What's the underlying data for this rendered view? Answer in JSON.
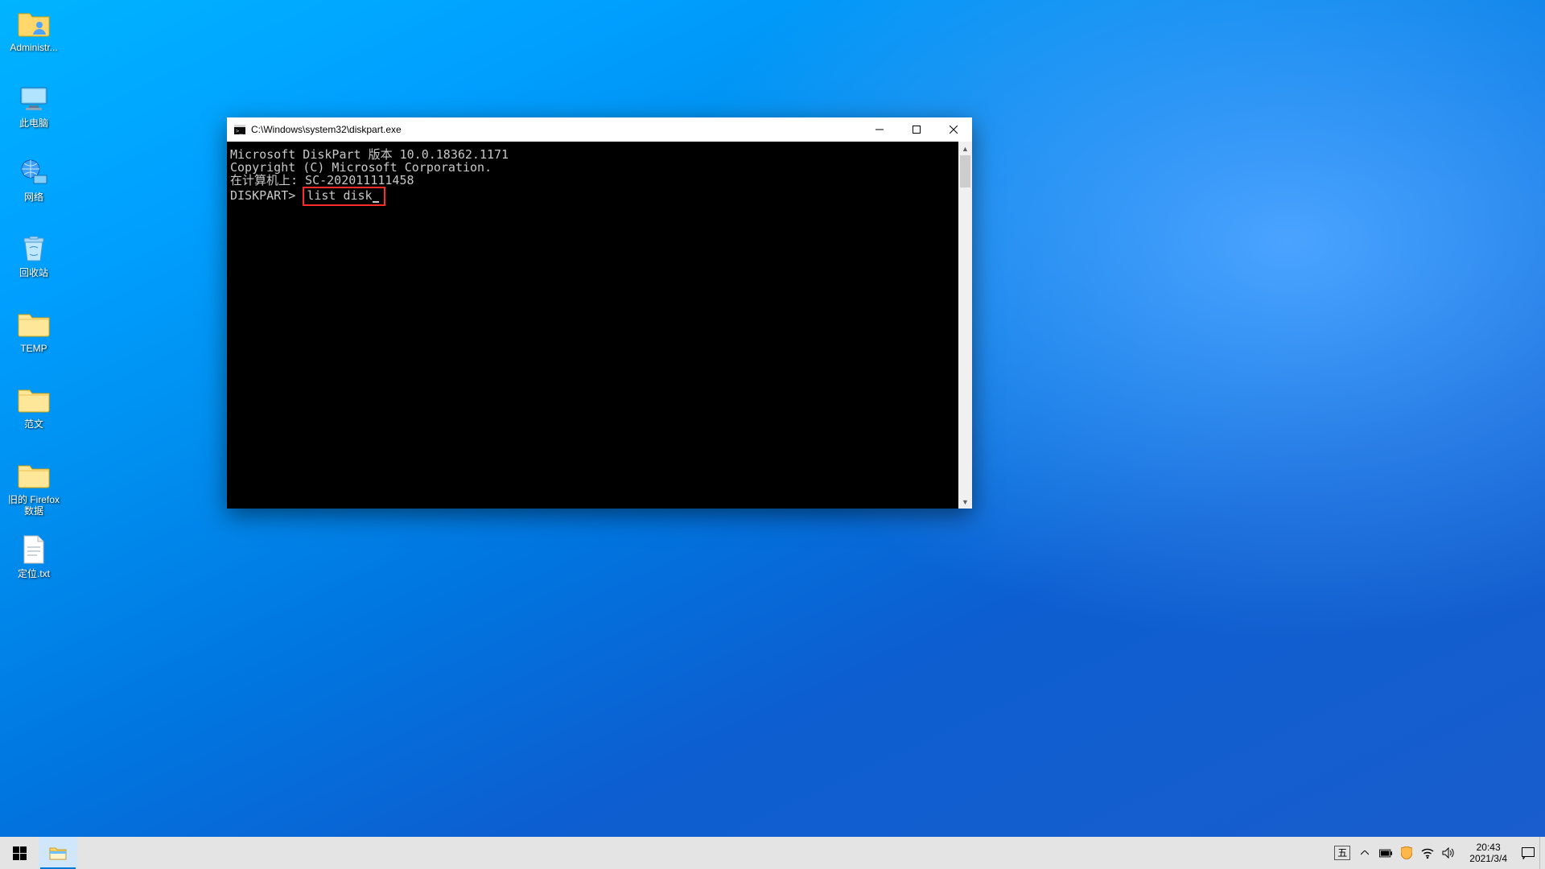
{
  "desktop_icons": {
    "admin": "Administr...",
    "pc": "此电脑",
    "net": "网络",
    "recycle": "回收站",
    "temp": "TEMP",
    "fanwen": "范文",
    "firefox": "旧的 Firefox 数据",
    "dingwei": "定位.txt"
  },
  "window": {
    "title": "C:\\Windows\\system32\\diskpart.exe",
    "lines": {
      "l1": "Microsoft DiskPart 版本 10.0.18362.1171",
      "l2": "",
      "l3": "Copyright (C) Microsoft Corporation.",
      "l4": "在计算机上: SC-202011111458",
      "l5": "",
      "prompt": "DISKPART> ",
      "cmd": "list disk"
    }
  },
  "taskbar": {
    "ime": "五",
    "clock_time": "20:43",
    "clock_date": "2021/3/4"
  }
}
